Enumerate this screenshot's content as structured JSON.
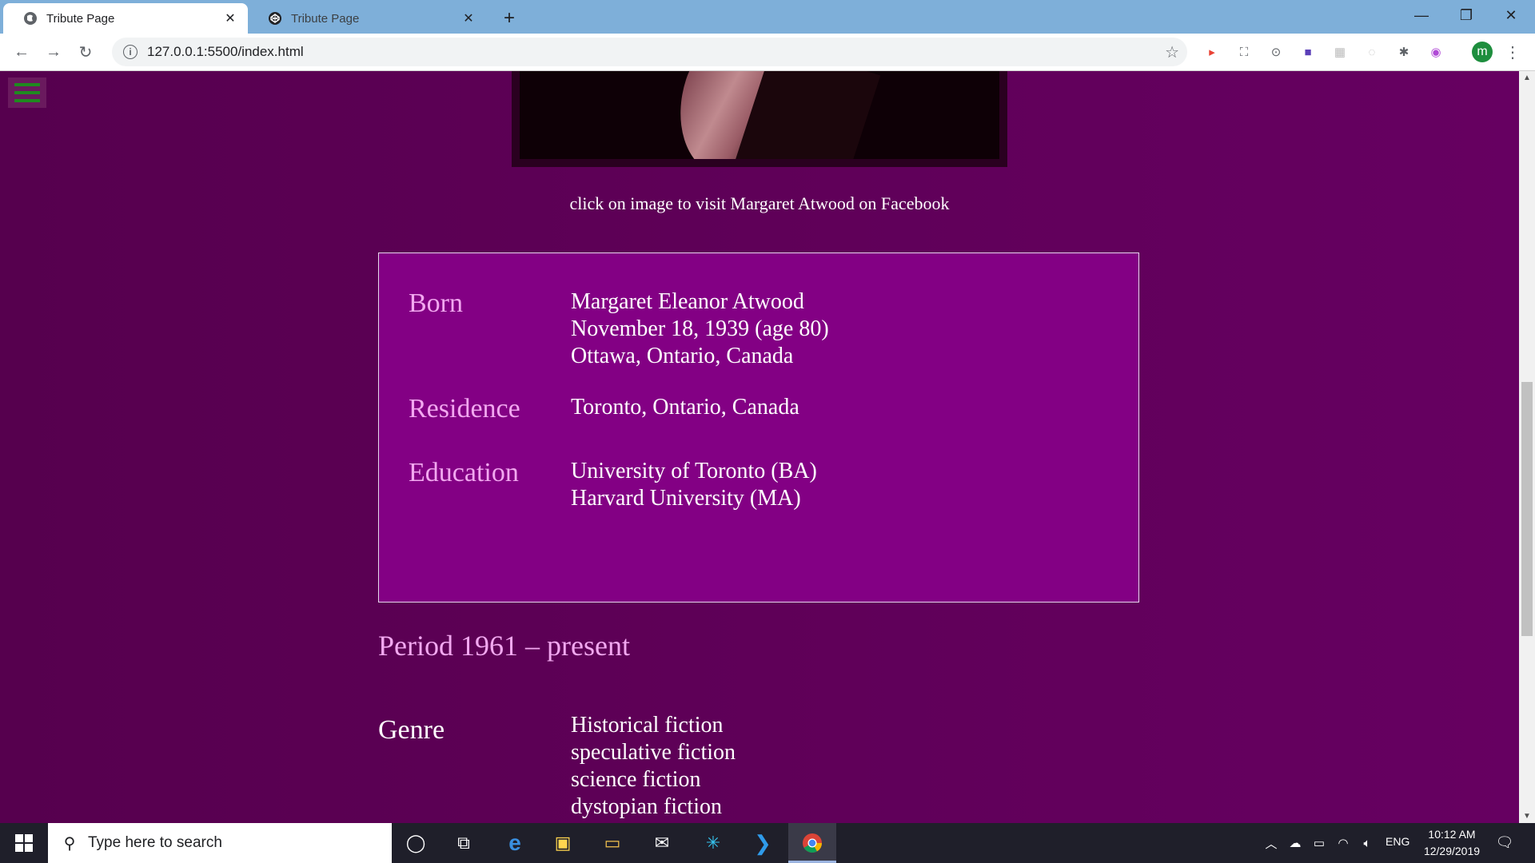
{
  "browser": {
    "tabs": [
      {
        "title": "Tribute Page",
        "active": true
      },
      {
        "title": "Tribute Page",
        "active": false
      }
    ],
    "new_tab_label": "+",
    "url": "127.0.0.1:5500/index.html",
    "profile_initial": "m",
    "extensions": [
      "bookmark-star-icon",
      "cast-icon",
      "screenshot-icon",
      "devtools-icon",
      "pocket-icon",
      "extension-icon",
      "tab-icon",
      "puzzle-icon",
      "broadcast-icon"
    ]
  },
  "page": {
    "caption": "click on image to visit Margaret Atwood on Facebook",
    "infobox": {
      "rows": [
        {
          "label": "Born",
          "values": [
            "Margaret Eleanor Atwood",
            "November 18, 1939 (age 80)",
            "Ottawa, Ontario, Canada"
          ]
        },
        {
          "label": "Residence",
          "values": [
            "Toronto, Ontario, Canada"
          ]
        },
        {
          "label": "Education",
          "values": [
            "University of Toronto (BA)",
            "Harvard University (MA)"
          ]
        }
      ]
    },
    "period": "Period 1961 – present",
    "genre": {
      "label": "Genre",
      "values": [
        "Historical fiction",
        "speculative fiction",
        "science fiction",
        "dystopian fiction"
      ]
    },
    "colors": {
      "background": "#5f0058",
      "infobox": "#830084",
      "label": "#f2a8f0",
      "text": "#ffffff",
      "menu_bars": "#1f8a1f"
    }
  },
  "taskbar": {
    "search_placeholder": "Type here to search",
    "language": "ENG",
    "time": "10:12 AM",
    "date": "12/29/2019"
  }
}
